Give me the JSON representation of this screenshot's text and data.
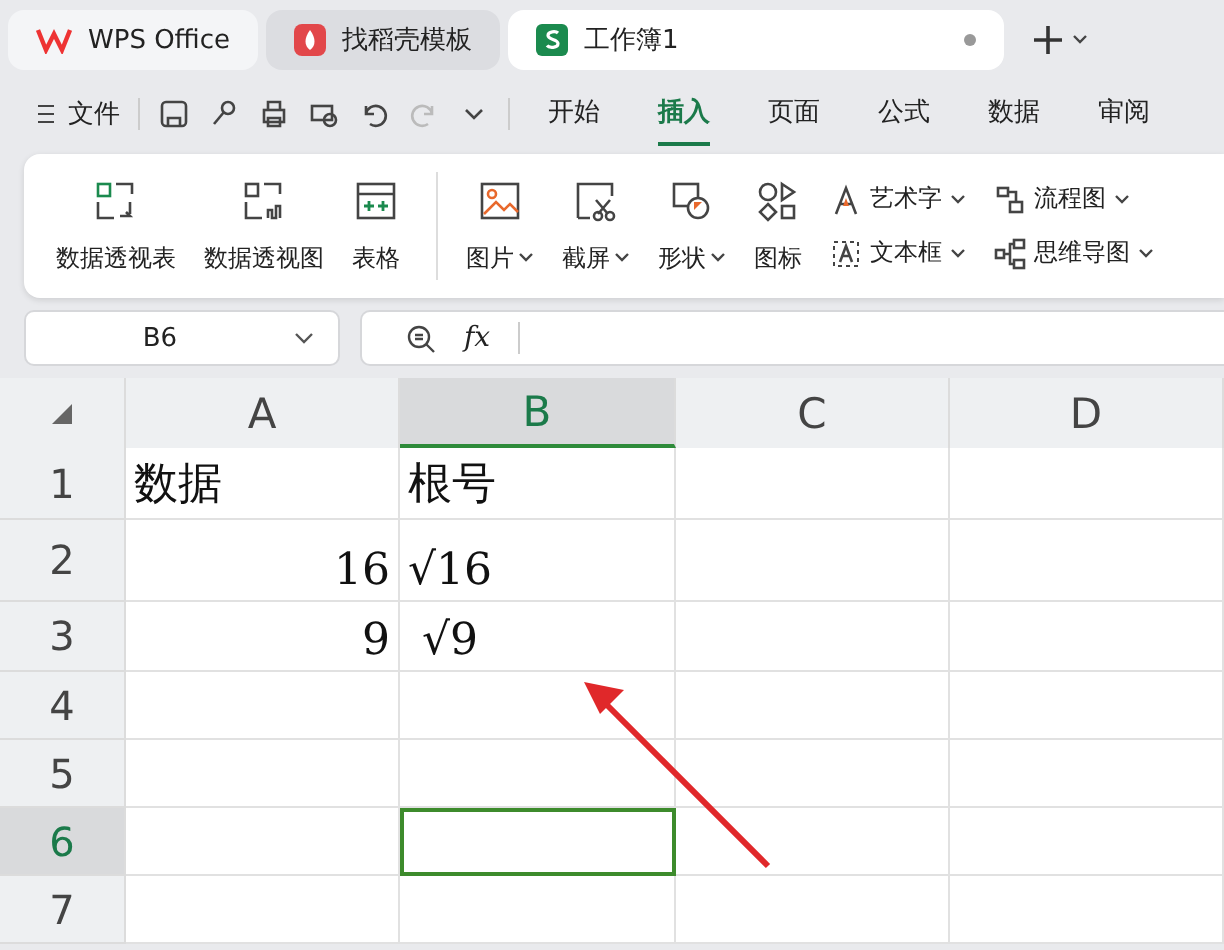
{
  "app_tabs": [
    {
      "label": "WPS Office",
      "selected": false,
      "kind": "home"
    },
    {
      "label": "找稻壳模板",
      "selected": false,
      "kind": "template"
    },
    {
      "label": "工作簿1",
      "selected": true,
      "kind": "sheet",
      "unsaved": true
    }
  ],
  "quick_toolbar": {
    "menu": "文件"
  },
  "menu_tabs": [
    {
      "label": "开始",
      "selected": false
    },
    {
      "label": "插入",
      "selected": true
    },
    {
      "label": "页面",
      "selected": false
    },
    {
      "label": "公式",
      "selected": false
    },
    {
      "label": "数据",
      "selected": false
    },
    {
      "label": "审阅",
      "selected": false
    }
  ],
  "ribbon": {
    "large": [
      {
        "label": "数据透视表",
        "dropdown": false
      },
      {
        "label": "数据透视图",
        "dropdown": false
      },
      {
        "label": "表格",
        "dropdown": false
      },
      {
        "label": "图片",
        "dropdown": true
      },
      {
        "label": "截屏",
        "dropdown": true
      },
      {
        "label": "形状",
        "dropdown": true
      },
      {
        "label": "图标",
        "dropdown": false
      }
    ],
    "small": [
      {
        "label": "艺术字",
        "dropdown": true
      },
      {
        "label": "文本框",
        "dropdown": true
      },
      {
        "label": "流程图",
        "dropdown": true
      },
      {
        "label": "思维导图",
        "dropdown": true
      }
    ]
  },
  "name_box": "B6",
  "formula_label": "fx",
  "grid": {
    "columns": [
      {
        "label": "A",
        "selected": false
      },
      {
        "label": "B",
        "selected": true
      },
      {
        "label": "C",
        "selected": false
      },
      {
        "label": "D",
        "selected": false
      }
    ],
    "rows": [
      {
        "label": "1",
        "selected": false,
        "cells": [
          {
            "text": "数据",
            "kind": "text",
            "selected": false
          },
          {
            "text": "根号",
            "kind": "text",
            "selected": false
          },
          {
            "selected": false
          },
          {
            "selected": false
          }
        ]
      },
      {
        "label": "2",
        "selected": false,
        "cells": [
          {
            "text": "16",
            "kind": "number",
            "selected": false
          },
          {
            "text": "√16",
            "kind": "text",
            "selected": false
          },
          {
            "selected": false
          },
          {
            "selected": false
          }
        ]
      },
      {
        "label": "3",
        "selected": false,
        "cells": [
          {
            "text": "9",
            "kind": "number",
            "selected": false
          },
          {
            "text": " √9",
            "kind": "text",
            "selected": false
          },
          {
            "selected": false
          },
          {
            "selected": false
          }
        ]
      },
      {
        "label": "4",
        "selected": false,
        "cells": [
          {
            "selected": false
          },
          {
            "selected": false
          },
          {
            "selected": false
          },
          {
            "selected": false
          }
        ]
      },
      {
        "label": "5",
        "selected": false,
        "cells": [
          {
            "selected": false
          },
          {
            "selected": false
          },
          {
            "selected": false
          },
          {
            "selected": false
          }
        ]
      },
      {
        "label": "6",
        "selected": true,
        "cells": [
          {
            "selected": false
          },
          {
            "selected": true
          },
          {
            "selected": false
          },
          {
            "selected": false
          }
        ]
      },
      {
        "label": "7",
        "selected": false,
        "cells": [
          {
            "selected": false
          },
          {
            "selected": false
          },
          {
            "selected": false
          },
          {
            "selected": false
          }
        ]
      }
    ]
  }
}
